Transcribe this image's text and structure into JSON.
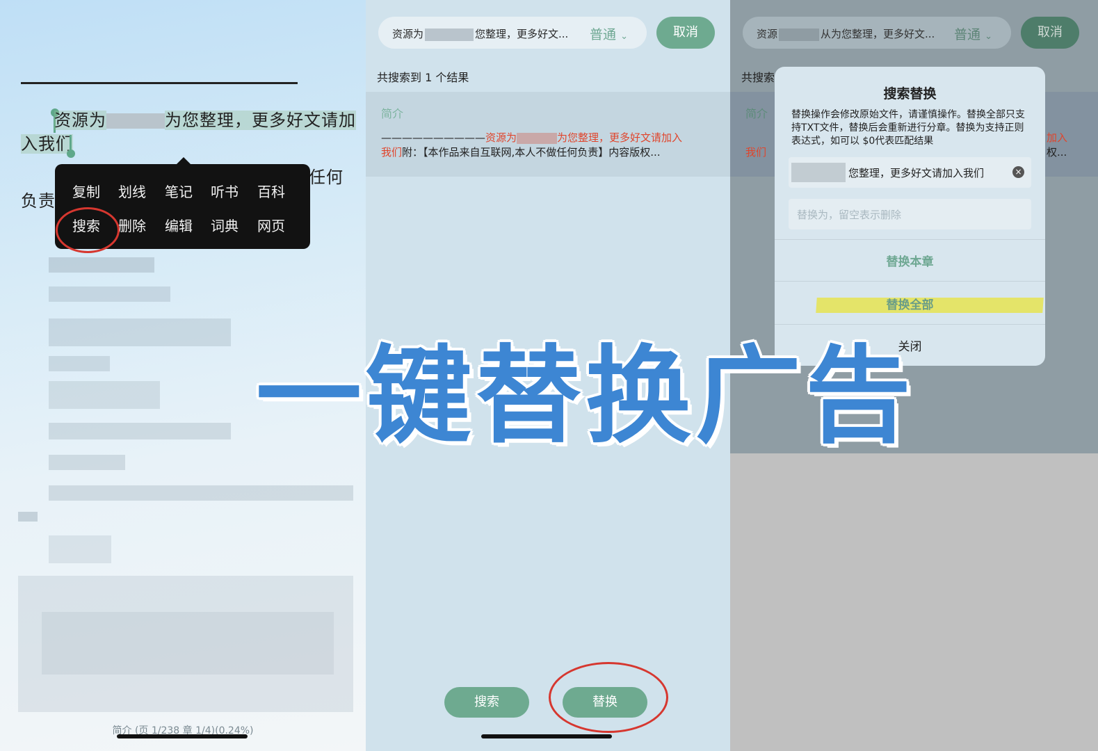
{
  "overlay": {
    "headline": "一键替换广告"
  },
  "reader": {
    "line1_a": "资源为",
    "line1_b": "为您整理，更多好文请加",
    "line2": "入我们",
    "line3_right": "任何",
    "line4_left": "负责",
    "menu_row1": [
      "复制",
      "划线",
      "笔记",
      "听书",
      "百科"
    ],
    "menu_row2": [
      "搜索",
      "删除",
      "编辑",
      "词典",
      "网页"
    ],
    "footer": "简介 (页 1/238 章 1/4)(0.24%)"
  },
  "search_panel": {
    "query": "资源为",
    "query_tail": "您整理，更多好文...",
    "mode": "普通",
    "cancel": "取消",
    "result_count": "共搜索到 1 个结果",
    "result_category": "简介",
    "result_line1_dash": "——————————",
    "result_line1_a": "资源为",
    "result_line1_b": "为您整理，更多好文请加入",
    "result_line2_red": "我们",
    "result_line2_rest": "附：【本作品来自互联网,本人不做任何负责】内容版权...",
    "search_button": "搜索",
    "replace_button": "替换"
  },
  "dialog_panel": {
    "query": "资源",
    "query_tail": "从为您整理，更多好文...",
    "mode": "普通",
    "cancel": "取消",
    "behind_count": "共搜索",
    "behind_category": "简介",
    "behind_red": "我们",
    "behind_right1": "加入",
    "behind_right2": "权...",
    "title": "搜索替换",
    "description": "替换操作会修改原始文件，请谨慎操作。替换全部只支持TXT文件，替换后会重新进行分章。替换为支持正则表达式，如可以 $0代表匹配结果",
    "find_value": "您整理，更多好文请加入我们",
    "replace_placeholder": "替换为，留空表示删除",
    "replace_chapter": "替换本章",
    "replace_all": "替换全部",
    "close": "关闭"
  },
  "colors": {
    "accent_green": "#6eaa90",
    "headline_blue": "#3d86d3",
    "highlight_red": "#e0452c",
    "annotation_red": "#d6372f",
    "marker_yellow": "#e5e35a"
  }
}
